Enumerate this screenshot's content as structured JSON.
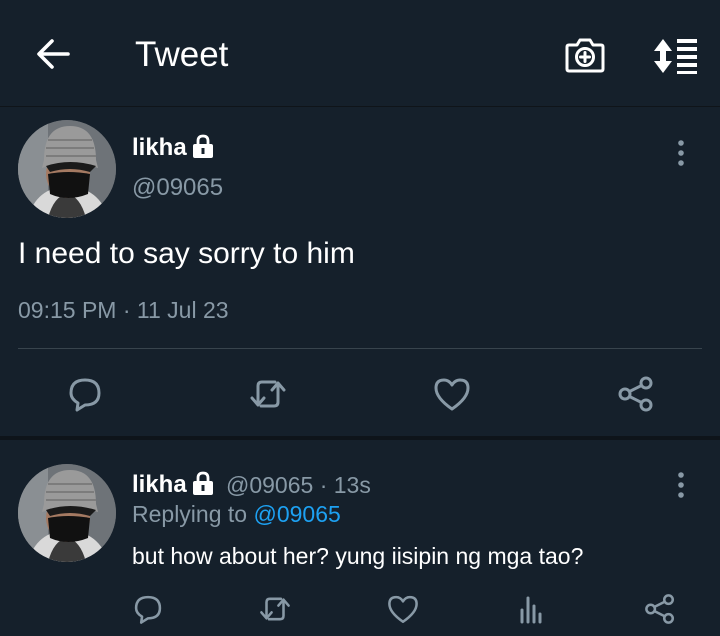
{
  "header": {
    "title": "Tweet",
    "icons": [
      "back-arrow-icon",
      "add-photo-icon",
      "sort-icon"
    ]
  },
  "tweet": {
    "author_name": "likha",
    "author_handle": "@09065",
    "text": "I need to say sorry to him",
    "meta": "09:15 PM · 11 Jul 23",
    "actions": [
      "reply-icon",
      "retweet-icon",
      "like-icon",
      "share-icon"
    ]
  },
  "reply": {
    "author_name": "likha",
    "author_handle": "@09065",
    "time": " · 13s",
    "replying_label": "Replying to ",
    "replying_to": "@09065",
    "text": "but how about her? yung iisipin ng mga tao?",
    "actions": [
      "reply-icon",
      "retweet-icon",
      "like-icon",
      "analytics-icon",
      "share-icon"
    ]
  },
  "colors": {
    "background": "#15202b",
    "text": "#ffffff",
    "secondary_text": "#8899a6",
    "link": "#1da1f2",
    "divider": "#38444d"
  }
}
